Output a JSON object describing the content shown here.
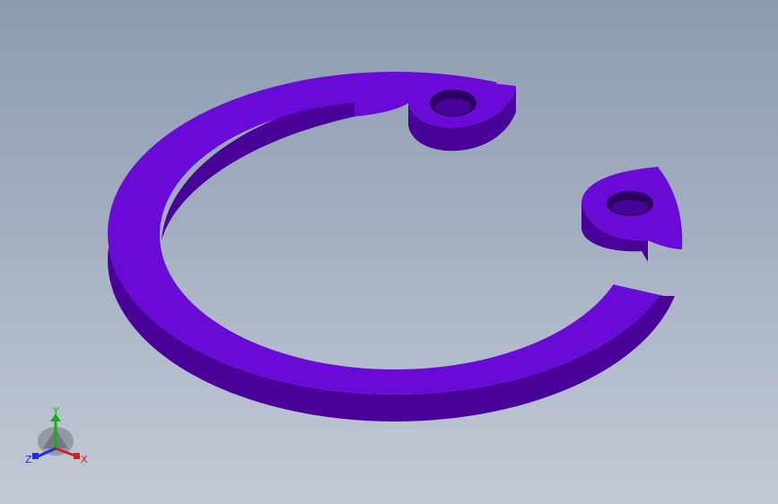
{
  "viewport": {
    "part_name": "",
    "part_color": "#6a0ad6",
    "part_side_color": "#4a0399",
    "part_edge_color": "#2c0060"
  },
  "triad": {
    "x_label": "X",
    "y_label": "Y",
    "z_label": "Z",
    "x_color": "#d42020",
    "y_color": "#14b014",
    "z_color": "#2030d8"
  }
}
